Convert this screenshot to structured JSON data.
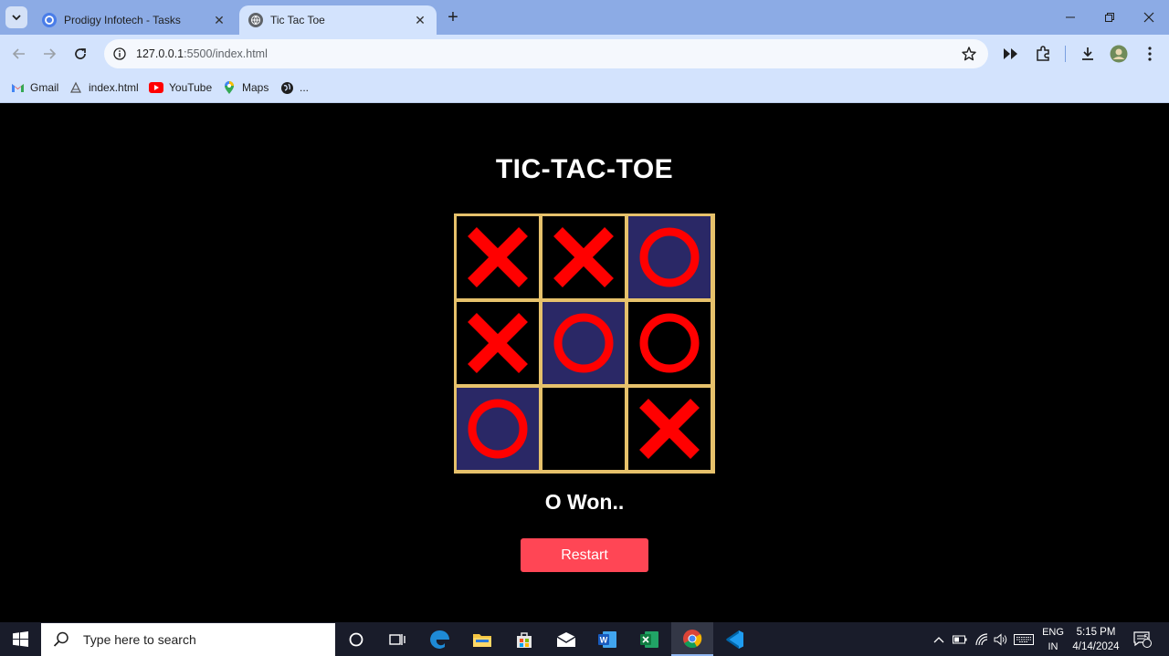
{
  "browser": {
    "tabs": [
      {
        "title": "Prodigy Infotech - Tasks",
        "active": false
      },
      {
        "title": "Tic Tac Toe",
        "active": true
      }
    ],
    "url_host": "127.0.0.1",
    "url_path": ":5500/index.html",
    "bookmarks": [
      {
        "label": "Gmail",
        "icon": "gmail-icon"
      },
      {
        "label": "index.html",
        "icon": "page-icon"
      },
      {
        "label": "YouTube",
        "icon": "youtube-icon"
      },
      {
        "label": "Maps",
        "icon": "maps-icon"
      },
      {
        "label": "...",
        "icon": "globe-icon"
      }
    ]
  },
  "game": {
    "title": "TIC-TAC-TOE",
    "board": [
      "X",
      "X",
      "O",
      "X",
      "O",
      "O",
      "O",
      "",
      "X"
    ],
    "winning_cells": [
      2,
      4,
      6
    ],
    "status": "O Won..",
    "restart_label": "Restart",
    "colors": {
      "mark": "#ff0000",
      "grid": "#e6c16b",
      "win_cell": "#2a2866",
      "button": "#ff4655"
    }
  },
  "taskbar": {
    "search_placeholder": "Type here to search",
    "language_line1": "ENG",
    "language_line2": "IN",
    "time": "5:15 PM",
    "date": "4/14/2024",
    "notification_count": "5"
  }
}
